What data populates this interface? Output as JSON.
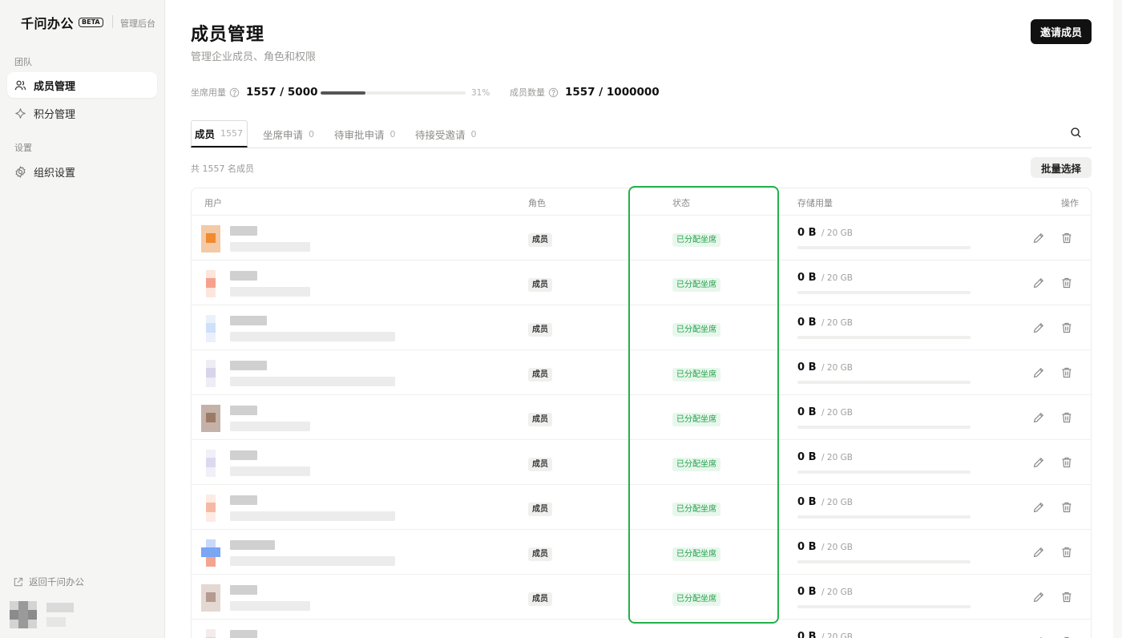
{
  "sidebar": {
    "brand": "千问办公",
    "beta": "BETA",
    "admin_label": "管理后台",
    "section_team": "团队",
    "nav_members": "成员管理",
    "nav_points": "积分管理",
    "section_settings": "设置",
    "nav_org": "组织设置",
    "back_link": "返回千问办公"
  },
  "header": {
    "title": "成员管理",
    "subtitle": "管理企业成员、角色和权限",
    "invite_button": "邀请成员"
  },
  "stats": {
    "seat_label": "坐席用量",
    "seat_value": "1557 / 5000",
    "seat_fraction": 0.31,
    "seat_percent": "31%",
    "member_label": "成员数量",
    "member_value": "1557 / 1000000"
  },
  "tabs": [
    {
      "label": "成员",
      "count": "1557"
    },
    {
      "label": "坐席申请",
      "count": "0"
    },
    {
      "label": "待审批申请",
      "count": "0"
    },
    {
      "label": "待接受邀请",
      "count": "0"
    }
  ],
  "toolbar": {
    "total_label": "共 1557 名成员",
    "batch_button": "批量选择"
  },
  "table": {
    "columns": [
      "用户",
      "角色",
      "状态",
      "存储用量",
      "操作"
    ],
    "rows": [
      {
        "role": "成员",
        "status": "已分配坐席",
        "storage_used": "0 B",
        "storage_quota": "/ 20 GB",
        "storage_fraction": 0
      },
      {
        "role": "成员",
        "status": "已分配坐席",
        "storage_used": "0 B",
        "storage_quota": "/ 20 GB",
        "storage_fraction": 0
      },
      {
        "role": "成员",
        "status": "已分配坐席",
        "storage_used": "0 B",
        "storage_quota": "/ 20 GB",
        "storage_fraction": 0
      },
      {
        "role": "成员",
        "status": "已分配坐席",
        "storage_used": "0 B",
        "storage_quota": "/ 20 GB",
        "storage_fraction": 0
      },
      {
        "role": "成员",
        "status": "已分配坐席",
        "storage_used": "0 B",
        "storage_quota": "/ 20 GB",
        "storage_fraction": 0
      },
      {
        "role": "成员",
        "status": "已分配坐席",
        "storage_used": "0 B",
        "storage_quota": "/ 20 GB",
        "storage_fraction": 0
      },
      {
        "role": "成员",
        "status": "已分配坐席",
        "storage_used": "0 B",
        "storage_quota": "/ 20 GB",
        "storage_fraction": 0
      },
      {
        "role": "成员",
        "status": "已分配坐席",
        "storage_used": "0 B",
        "storage_quota": "/ 20 GB",
        "storage_fraction": 0
      },
      {
        "role": "成员",
        "status": "已分配坐席",
        "storage_used": "0 B",
        "storage_quota": "/ 20 GB",
        "storage_fraction": 0
      },
      {
        "role": "",
        "status": "",
        "storage_used": "0 B",
        "storage_quota": "/ 20 GB",
        "storage_fraction": 0
      }
    ]
  },
  "colors": {
    "accent": "#111111",
    "status_green": "#21a14a",
    "status_bg": "#e8f7ec",
    "highlight": "#25b14a"
  },
  "icons": [
    "people-icon",
    "sparkle-icon",
    "gear-icon",
    "help-icon",
    "search-icon",
    "external-link-icon",
    "edit-icon",
    "trash-icon"
  ]
}
